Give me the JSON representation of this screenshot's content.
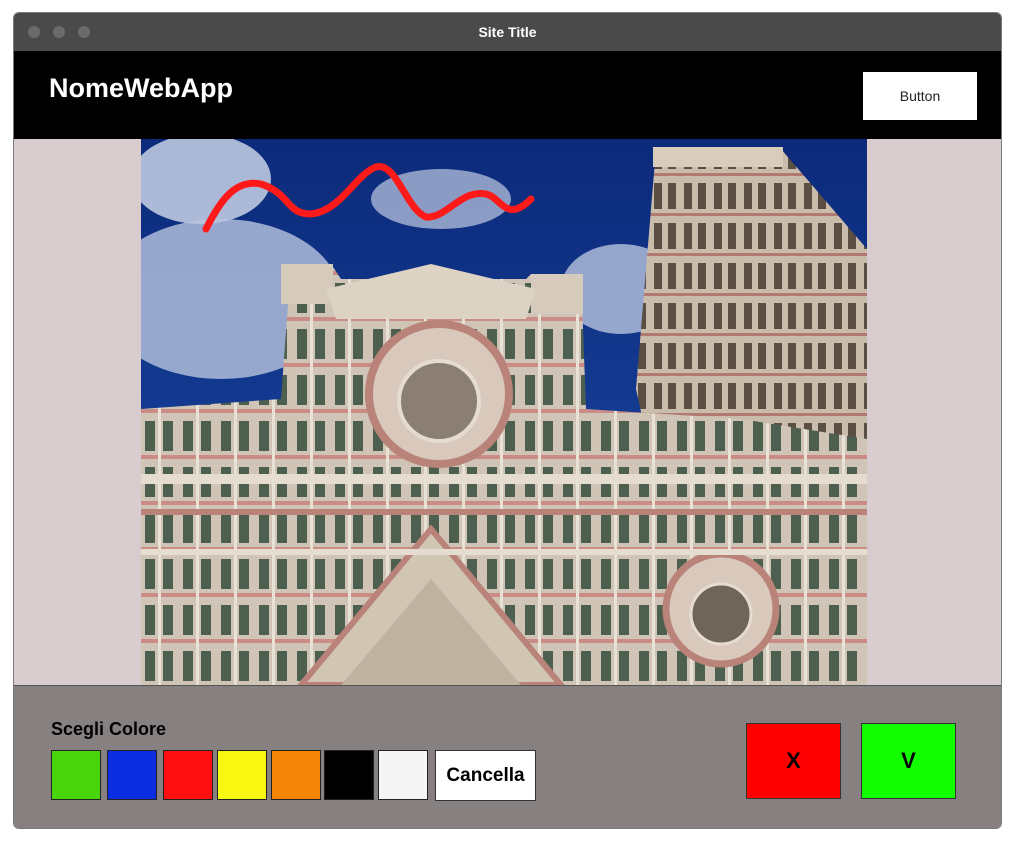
{
  "window": {
    "title": "Site Title"
  },
  "header": {
    "app_name": "NomeWebApp",
    "button_label": "Button"
  },
  "canvas": {
    "image_name": "florence-cathedral-photo",
    "drawn_stroke_color": "#ff1a1a"
  },
  "toolbar": {
    "label": "Scegli Colore",
    "colors": [
      {
        "name": "green",
        "hex": "#48d60a"
      },
      {
        "name": "blue",
        "hex": "#0a2de0"
      },
      {
        "name": "red",
        "hex": "#ff0f0f"
      },
      {
        "name": "yellow",
        "hex": "#f7f712"
      },
      {
        "name": "orange",
        "hex": "#f58506"
      },
      {
        "name": "black",
        "hex": "#000000"
      },
      {
        "name": "white",
        "hex": "#f5f5f5"
      }
    ],
    "clear_label": "Cancella",
    "cancel_label": "X",
    "cancel_color": "#ff0000",
    "confirm_label": "V",
    "confirm_color": "#11ff00"
  }
}
